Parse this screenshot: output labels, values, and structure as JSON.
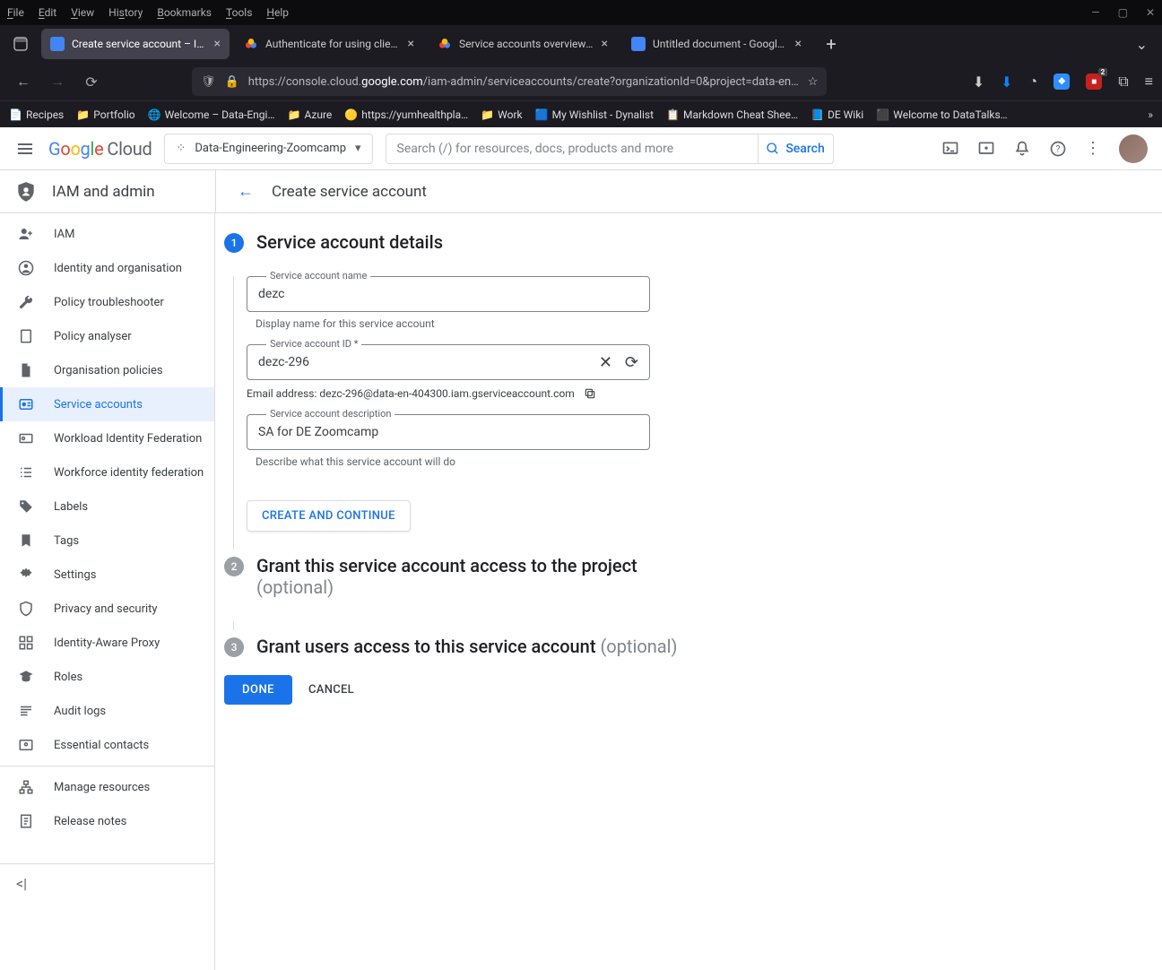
{
  "browser": {
    "menus": [
      "File",
      "Edit",
      "View",
      "History",
      "Bookmarks",
      "Tools",
      "Help"
    ],
    "tabs": [
      {
        "title": "Create service account – IAM an",
        "active": true,
        "favicon": "#4285f4"
      },
      {
        "title": "Authenticate for using client lib",
        "active": false,
        "favicon": "gcp"
      },
      {
        "title": "Service accounts overview  |  IA",
        "active": false,
        "favicon": "gcp"
      },
      {
        "title": "Untitled document - Google Do",
        "active": false,
        "favicon": "#4285f4"
      }
    ],
    "url_prefix": "https://console.cloud.",
    "url_host": "google.com",
    "url_path": "/iam-admin/serviceaccounts/create?organizationId=0&project=data-en…",
    "bookmarks": [
      "Recipes",
      "Portfolio",
      "Welcome – Data-Engi…",
      "Azure",
      "https://yumhealthpla…",
      "Work",
      "My Wishlist - Dynalist",
      "Markdown Cheat Shee…",
      "DE Wiki",
      "Welcome to DataTalks…"
    ]
  },
  "header": {
    "logo_cloud": "Cloud",
    "project": "Data-Engineering-Zoomcamp",
    "search_placeholder": "Search (/) for resources, docs, products and more",
    "search_btn": "Search"
  },
  "subnav": {
    "section": "IAM and admin",
    "page": "Create service account"
  },
  "sidenav": [
    {
      "icon": "person-add",
      "label": "IAM"
    },
    {
      "icon": "account-circle",
      "label": "Identity and organisation"
    },
    {
      "icon": "wrench",
      "label": "Policy troubleshooter"
    },
    {
      "icon": "doc",
      "label": "Policy analyser"
    },
    {
      "icon": "file",
      "label": "Organisation policies"
    },
    {
      "icon": "badge",
      "label": "Service accounts",
      "active": true
    },
    {
      "icon": "id",
      "label": "Workload Identity Federation"
    },
    {
      "icon": "list",
      "label": "Workforce identity federation"
    },
    {
      "icon": "tag",
      "label": "Labels"
    },
    {
      "icon": "bookmark",
      "label": "Tags"
    },
    {
      "icon": "gear",
      "label": "Settings"
    },
    {
      "icon": "shield",
      "label": "Privacy and security"
    },
    {
      "icon": "grid",
      "label": "Identity-Aware Proxy"
    },
    {
      "icon": "hat",
      "label": "Roles"
    },
    {
      "icon": "lines",
      "label": "Audit logs"
    },
    {
      "icon": "contact",
      "label": "Essential contacts"
    }
  ],
  "sidenav_footer": [
    {
      "icon": "tree",
      "label": "Manage resources"
    },
    {
      "icon": "note",
      "label": "Release notes"
    }
  ],
  "form": {
    "step1_title": "Service account details",
    "name_label": "Service account name",
    "name_value": "dezc",
    "name_hint": "Display name for this service account",
    "id_label": "Service account ID *",
    "id_value": "dezc-296",
    "email_label": "Email address: dezc-296@data-en-404300.iam.gserviceaccount.com",
    "desc_label": "Service account description",
    "desc_value": "SA for DE Zoomcamp",
    "desc_hint": "Describe what this service account will do",
    "create_continue": "CREATE AND CONTINUE",
    "step2_title": "Grant this service account access to the project",
    "step2_opt": "(optional)",
    "step3_title": "Grant users access to this service account ",
    "step3_opt": "(optional)",
    "done": "DONE",
    "cancel": "CANCEL"
  }
}
